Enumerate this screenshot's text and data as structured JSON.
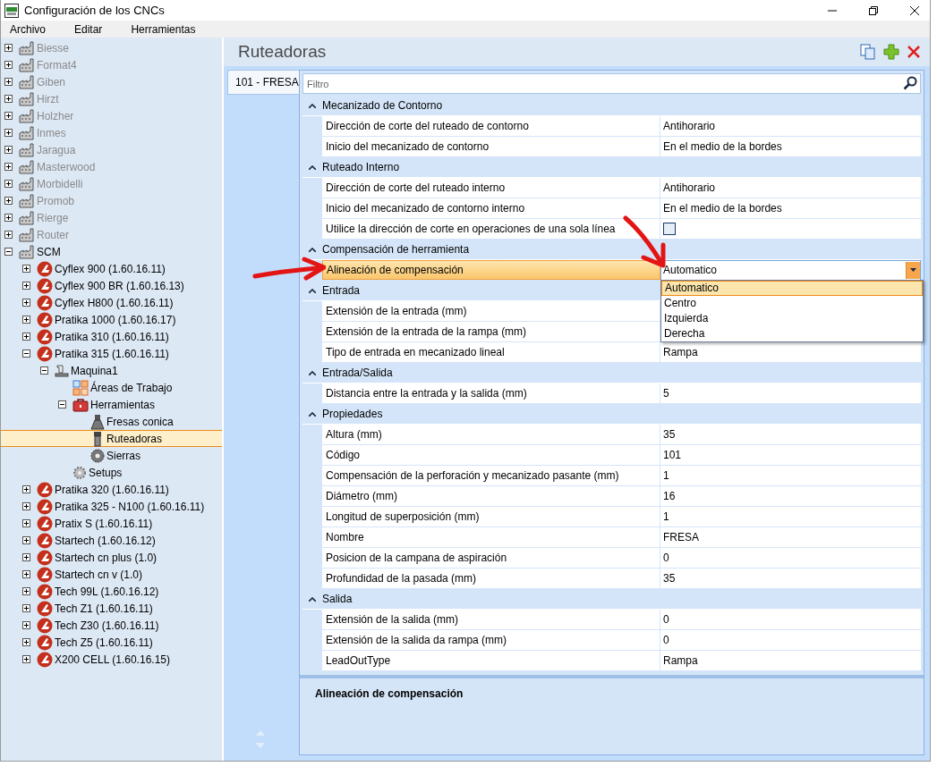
{
  "window": {
    "title": "Configuración de los CNCs"
  },
  "menu": [
    "Archivo",
    "Editar",
    "Herramientas"
  ],
  "tree": [
    {
      "label": "Biesse",
      "kind": "manufacturer",
      "dimmed": true,
      "expanded": false,
      "selected": false
    },
    {
      "label": "Format4",
      "kind": "manufacturer",
      "dimmed": true,
      "expanded": false,
      "selected": false
    },
    {
      "label": "Giben",
      "kind": "manufacturer",
      "dimmed": true,
      "expanded": false,
      "selected": false
    },
    {
      "label": "Hirzt",
      "kind": "manufacturer",
      "dimmed": true,
      "expanded": false,
      "selected": false
    },
    {
      "label": "Holzher",
      "kind": "manufacturer",
      "dimmed": true,
      "expanded": false,
      "selected": false
    },
    {
      "label": "Inmes",
      "kind": "manufacturer",
      "dimmed": true,
      "expanded": false,
      "selected": false
    },
    {
      "label": "Jaragua",
      "kind": "manufacturer",
      "dimmed": true,
      "expanded": false,
      "selected": false
    },
    {
      "label": "Masterwood",
      "kind": "manufacturer",
      "dimmed": true,
      "expanded": false,
      "selected": false
    },
    {
      "label": "Morbidelli",
      "kind": "manufacturer",
      "dimmed": true,
      "expanded": false,
      "selected": false
    },
    {
      "label": "Promob",
      "kind": "manufacturer",
      "dimmed": true,
      "expanded": false,
      "selected": false
    },
    {
      "label": "Rierge",
      "kind": "manufacturer",
      "dimmed": true,
      "expanded": false,
      "selected": false
    },
    {
      "label": "Router",
      "kind": "manufacturer",
      "dimmed": true,
      "expanded": false,
      "selected": false
    },
    {
      "label": "SCM",
      "kind": "manufacturer",
      "dimmed": false,
      "expanded": true,
      "selected": false,
      "children": [
        {
          "label": "Cyflex 900 (1.60.16.11)",
          "kind": "machine",
          "dimmed": false,
          "expanded": false,
          "selected": false
        },
        {
          "label": "Cyflex 900 BR (1.60.16.13)",
          "kind": "machine",
          "dimmed": false,
          "expanded": false,
          "selected": false
        },
        {
          "label": "Cyflex H800 (1.60.16.11)",
          "kind": "machine",
          "dimmed": false,
          "expanded": false,
          "selected": false
        },
        {
          "label": "Pratika 1000 (1.60.16.17)",
          "kind": "machine",
          "dimmed": false,
          "expanded": false,
          "selected": false
        },
        {
          "label": "Pratika 310 (1.60.16.11)",
          "kind": "machine",
          "dimmed": false,
          "expanded": false,
          "selected": false
        },
        {
          "label": "Pratika 315 (1.60.16.11)",
          "kind": "machine",
          "dimmed": false,
          "expanded": true,
          "selected": false,
          "children": [
            {
              "label": "Maquina1",
              "kind": "station",
              "dimmed": false,
              "expanded": true,
              "selected": false,
              "children": [
                {
                  "label": "Áreas de Trabajo",
                  "kind": "areas",
                  "dimmed": false,
                  "selected": false
                },
                {
                  "label": "Herramientas",
                  "kind": "toolbox",
                  "dimmed": false,
                  "expanded": true,
                  "selected": false,
                  "children": [
                    {
                      "label": "Fresas conica",
                      "kind": "conic",
                      "dimmed": false,
                      "selected": false
                    },
                    {
                      "label": "Ruteadoras",
                      "kind": "router",
                      "dimmed": false,
                      "selected": true
                    },
                    {
                      "label": "Sierras",
                      "kind": "saw",
                      "dimmed": false,
                      "selected": false
                    }
                  ]
                },
                {
                  "label": "Setups",
                  "kind": "setups",
                  "dimmed": false,
                  "selected": false
                }
              ]
            }
          ]
        },
        {
          "label": "Pratika 320 (1.60.16.11)",
          "kind": "machine",
          "dimmed": false,
          "expanded": false,
          "selected": false
        },
        {
          "label": "Pratika 325 - N100 (1.60.16.11)",
          "kind": "machine",
          "dimmed": false,
          "expanded": false,
          "selected": false
        },
        {
          "label": "Pratix S (1.60.16.11)",
          "kind": "machine",
          "dimmed": false,
          "expanded": false,
          "selected": false
        },
        {
          "label": "Startech (1.60.16.12)",
          "kind": "machine",
          "dimmed": false,
          "expanded": false,
          "selected": false
        },
        {
          "label": "Startech cn plus (1.0)",
          "kind": "machine",
          "dimmed": false,
          "expanded": false,
          "selected": false
        },
        {
          "label": "Startech cn v (1.0)",
          "kind": "machine",
          "dimmed": false,
          "expanded": false,
          "selected": false
        },
        {
          "label": "Tech 99L (1.60.16.12)",
          "kind": "machine",
          "dimmed": false,
          "expanded": false,
          "selected": false
        },
        {
          "label": "Tech Z1 (1.60.16.11)",
          "kind": "machine",
          "dimmed": false,
          "expanded": false,
          "selected": false
        },
        {
          "label": "Tech Z30 (1.60.16.11)",
          "kind": "machine",
          "dimmed": false,
          "expanded": false,
          "selected": false
        },
        {
          "label": "Tech Z5 (1.60.16.11)",
          "kind": "machine",
          "dimmed": false,
          "expanded": false,
          "selected": false
        },
        {
          "label": "X200 CELL (1.60.16.15)",
          "kind": "machine",
          "dimmed": false,
          "expanded": false,
          "selected": false
        }
      ]
    }
  ],
  "panel": {
    "title": "Ruteadoras"
  },
  "tabs": [
    {
      "label": "101 - FRESA",
      "selected": true
    }
  ],
  "filter": {
    "placeholder": "Filtro"
  },
  "sections": [
    {
      "label": "Mecanizado de Contorno",
      "expanded": true,
      "rows": [
        {
          "label": "Dirección de corte del ruteado de contorno",
          "kind": "text",
          "value": "Antihorario",
          "selected": false
        },
        {
          "label": "Inicio del mecanizado de contorno",
          "kind": "text",
          "value": "En el medio de la bordes",
          "selected": false
        }
      ]
    },
    {
      "label": "Ruteado Interno",
      "expanded": true,
      "rows": [
        {
          "label": "Dirección de corte del ruteado interno",
          "kind": "text",
          "value": "Antihorario",
          "selected": false
        },
        {
          "label": "Inicio del mecanizado de contorno interno",
          "kind": "text",
          "value": "En el medio de la bordes",
          "selected": false
        },
        {
          "label": "Utilice la dirección de corte en operaciones de una sola línea",
          "kind": "checkbox",
          "checked": false,
          "selected": false
        }
      ]
    },
    {
      "label": "Compensación de herramienta",
      "expanded": true,
      "rows": [
        {
          "label": "Alineación de compensación",
          "kind": "dropdown",
          "value": "Automatico",
          "selected": true,
          "options": [
            {
              "label": "Automatico",
              "selected": true
            },
            {
              "label": "Centro",
              "selected": false
            },
            {
              "label": "Izquierda",
              "selected": false
            },
            {
              "label": "Derecha",
              "selected": false
            }
          ]
        }
      ]
    },
    {
      "label": "Entrada",
      "expanded": true,
      "rows": [
        {
          "label": "Extensión de la entrada (mm)",
          "kind": "text",
          "selected": false
        },
        {
          "label": "Extensión de la entrada de la rampa (mm)",
          "kind": "text",
          "selected": false
        },
        {
          "label": "Tipo de entrada en mecanizado lineal",
          "kind": "text",
          "value": "Rampa",
          "selected": false
        }
      ]
    },
    {
      "label": "Entrada/Salida",
      "expanded": true,
      "rows": [
        {
          "label": "Distancia entre la entrada y la salida (mm)",
          "kind": "text",
          "value": "5",
          "selected": false
        }
      ]
    },
    {
      "label": "Propiedades",
      "expanded": true,
      "rows": [
        {
          "label": "Altura (mm)",
          "kind": "text",
          "value": "35",
          "selected": false
        },
        {
          "label": "Código",
          "kind": "text",
          "value": "101",
          "selected": false
        },
        {
          "label": "Compensación de la perforación y mecanizado pasante (mm)",
          "kind": "text",
          "value": "1",
          "selected": false
        },
        {
          "label": "Diámetro (mm)",
          "kind": "text",
          "value": "16",
          "selected": false
        },
        {
          "label": "Longitud de superposición (mm)",
          "kind": "text",
          "value": "1",
          "selected": false
        },
        {
          "label": "Nombre",
          "kind": "text",
          "value": "FRESA",
          "selected": false
        },
        {
          "label": "Posicion de la campana de aspiración",
          "kind": "text",
          "value": "0",
          "selected": false
        },
        {
          "label": "Profundidad de la pasada (mm)",
          "kind": "text",
          "value": "35",
          "selected": false
        }
      ]
    },
    {
      "label": "Salida",
      "expanded": true,
      "rows": [
        {
          "label": "Extensión de la salida (mm)",
          "kind": "text",
          "value": "0",
          "selected": false
        },
        {
          "label": "Extensión de la salida da rampa (mm)",
          "kind": "text",
          "value": "0",
          "selected": false
        },
        {
          "label": "LeadOutType",
          "kind": "text",
          "value": "Rampa",
          "selected": false
        }
      ]
    }
  ],
  "description": {
    "title": "Alineación de compensación"
  }
}
